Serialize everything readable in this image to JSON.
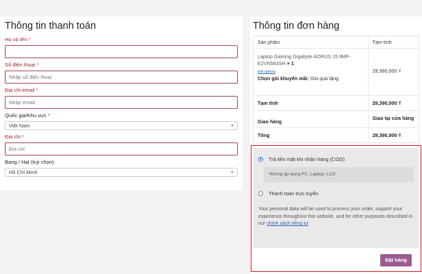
{
  "billing": {
    "title": "Thông tin thanh toán",
    "name_label": "Họ và tên",
    "name_value": "",
    "phone_label": "Số điện thoại",
    "phone_placeholder": "Nhập số điện thoại",
    "email_label": "Địa chỉ email",
    "email_placeholder": "Nhập email",
    "country_label": "Quốc gia/Khu vực",
    "country_value": "Việt Nam",
    "address_label": "Địa chỉ",
    "address_placeholder": "Địa chỉ",
    "state_label": "Bang / Hạt (tuỳ chọn)",
    "state_value": "Hồ Chí Minh",
    "required_mark": "*"
  },
  "order": {
    "title": "Thông tin đơn hàng",
    "col_product": "Sản phẩm",
    "col_subtotal": "Tạm tính",
    "product_name": "Laptop Gaming Gigabyte AORUS 15 9MF-E2VN583SH",
    "product_qty": "× 1",
    "edit_options": "Edit options",
    "promo_label": "Chọn gói khuyến mãi:",
    "promo_value": "Gói quà tặng",
    "product_price": "29,390,000 ₫",
    "subtotal_label": "Tạm tính",
    "subtotal_value": "29,390,000 ₫",
    "shipping_label": "Giao hàng",
    "shipping_value": "Giao tại cửa hàng",
    "total_label": "Tổng",
    "total_value": "29,390,000 ₫"
  },
  "payment": {
    "cod_label": "Trả tiền mặt khi nhận hàng (COD)",
    "cod_note": "*không áp dụng PC, Laptop, LCD",
    "online_label": "Thanh toán trực tuyến",
    "privacy_text": "Your personal data will be used to process your order, support your experience throughout this website, and for other purposes described in our",
    "privacy_link": "chính sách riêng tư",
    "privacy_end": ".",
    "place_order": "Đặt hàng"
  }
}
